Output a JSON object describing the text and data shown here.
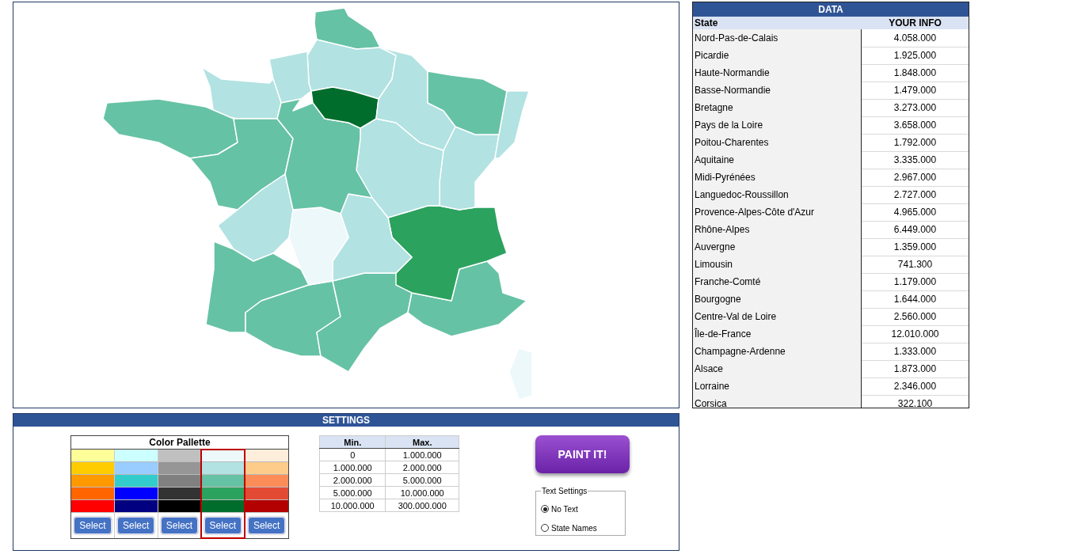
{
  "data_table": {
    "title": "DATA",
    "columns": [
      "State",
      "YOUR INFO"
    ],
    "rows": [
      {
        "state": "Nord-Pas-de-Calais",
        "value": "4.058.000"
      },
      {
        "state": "Picardie",
        "value": "1.925.000"
      },
      {
        "state": "Haute-Normandie",
        "value": "1.848.000"
      },
      {
        "state": "Basse-Normandie",
        "value": "1.479.000"
      },
      {
        "state": "Bretagne",
        "value": "3.273.000"
      },
      {
        "state": "Pays de la Loire",
        "value": "3.658.000"
      },
      {
        "state": "Poitou-Charentes",
        "value": "1.792.000"
      },
      {
        "state": "Aquitaine",
        "value": "3.335.000"
      },
      {
        "state": "Midi-Pyrénées",
        "value": "2.967.000"
      },
      {
        "state": "Languedoc-Roussillon",
        "value": "2.727.000"
      },
      {
        "state": "Provence-Alpes-Côte d'Azur",
        "value": "4.965.000"
      },
      {
        "state": "Rhône-Alpes",
        "value": "6.449.000"
      },
      {
        "state": "Auvergne",
        "value": "1.359.000"
      },
      {
        "state": "Limousin",
        "value": "741.300"
      },
      {
        "state": "Franche-Comté",
        "value": "1.179.000"
      },
      {
        "state": "Bourgogne",
        "value": "1.644.000"
      },
      {
        "state": "Centre-Val de Loire",
        "value": "2.560.000"
      },
      {
        "state": "Île-de-France",
        "value": "12.010.000"
      },
      {
        "state": "Champagne-Ardenne",
        "value": "1.333.000"
      },
      {
        "state": "Alsace",
        "value": "1.873.000"
      },
      {
        "state": "Lorraine",
        "value": "2.346.000"
      },
      {
        "state": "Corsica",
        "value": "322.100"
      }
    ]
  },
  "settings": {
    "title": "SETTINGS",
    "palette": {
      "title": "Color Pallette",
      "columns": [
        {
          "swatches": [
            {
              "color": "#ffff99"
            },
            {
              "color": "#ffcc00"
            },
            {
              "color": "#ff9900"
            },
            {
              "color": "#ff6600"
            },
            {
              "color": "#ff0000"
            }
          ],
          "button": "Select",
          "selected": false
        },
        {
          "swatches": [
            {
              "color": "#ccffff"
            },
            {
              "color": "#99ccff"
            },
            {
              "color": "#33cccc"
            },
            {
              "color": "#0000ff"
            },
            {
              "color": "#000080"
            }
          ],
          "button": "Select",
          "selected": false
        },
        {
          "swatches": [
            {
              "color": "#c0c0c0"
            },
            {
              "color": "#969696"
            },
            {
              "color": "#808080"
            },
            {
              "color": "#333333"
            },
            {
              "color": "#000000"
            }
          ],
          "button": "Select",
          "selected": false
        },
        {
          "swatches": [
            {
              "color": "#edf8fb"
            },
            {
              "color": "#b2e2e2"
            },
            {
              "color": "#66c2a4"
            },
            {
              "color": "#2ca25f"
            },
            {
              "color": "#006d2c"
            }
          ],
          "button": "Select",
          "selected": true
        },
        {
          "swatches": [
            {
              "color": "#fdeedb"
            },
            {
              "color": "#fdcc8a"
            },
            {
              "color": "#fc8d59"
            },
            {
              "color": "#e34a33"
            },
            {
              "color": "#b30000"
            }
          ],
          "button": "Select",
          "selected": false
        }
      ]
    },
    "ranges": {
      "columns": [
        "Min.",
        "Max."
      ],
      "rows": [
        [
          "0",
          "1.000.000"
        ],
        [
          "1.000.000",
          "2.000.000"
        ],
        [
          "2.000.000",
          "5.000.000"
        ],
        [
          "5.000.000",
          "10.000.000"
        ],
        [
          "10.000.000",
          "300.000.000"
        ]
      ]
    },
    "paint_button": "PAINT IT!",
    "text_settings": {
      "title": "Text Settings",
      "options": [
        {
          "label": "No Text",
          "selected": true
        },
        {
          "label": "State Names",
          "selected": false
        }
      ]
    }
  }
}
